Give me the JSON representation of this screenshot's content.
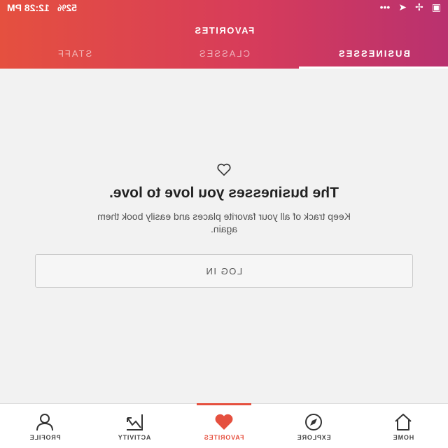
{
  "status_bar": {
    "time": "12:28 PM",
    "battery": "52%"
  },
  "header": {
    "title": "FAVORITES",
    "tabs": [
      {
        "label": "STAFF",
        "active": false
      },
      {
        "label": "CLASSES",
        "active": false
      },
      {
        "label": "BUSINESSES",
        "active": true
      }
    ]
  },
  "empty_state": {
    "icon": "heart-outline-icon",
    "headline": "The businesses you love to love.",
    "subtext": "Keep track of all your favorite places and easily book them again.",
    "login_label": "LOG IN"
  },
  "bottom_nav": {
    "items": [
      {
        "label": "PROFILE",
        "icon": "person-icon",
        "active": false
      },
      {
        "label": "ACTIVITY",
        "icon": "activity-chart-icon",
        "active": false
      },
      {
        "label": "FAVORITES",
        "icon": "heart-icon",
        "active": true
      },
      {
        "label": "EXPLORE",
        "icon": "compass-icon",
        "active": false
      },
      {
        "label": "HOME",
        "icon": "home-icon",
        "active": false
      }
    ]
  },
  "colors": {
    "accent": "#e5503f",
    "gradient_start": "#e5503f",
    "gradient_end": "#b9316f"
  }
}
